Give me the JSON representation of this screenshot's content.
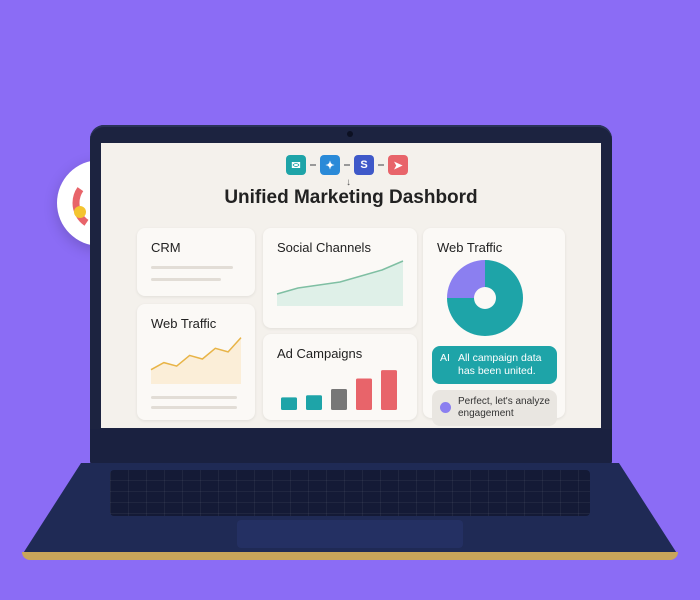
{
  "dashboard": {
    "title": "Unified Marketing Dashbord",
    "integrations": [
      {
        "name": "chat-app",
        "glyph": "✉",
        "color": "#1ea4a8"
      },
      {
        "name": "twitter",
        "glyph": "✦",
        "color": "#2a8ad8"
      },
      {
        "name": "skype",
        "glyph": "S",
        "color": "#3f59c9"
      },
      {
        "name": "send-app",
        "glyph": "➤",
        "color": "#e8646a"
      }
    ],
    "cards": {
      "crm": "CRM",
      "social": "Social Channels",
      "web_traffic_left": "Web Traffic",
      "ads": "Ad Campaigns",
      "web_traffic_right": "Web Traffic"
    },
    "chat": {
      "ai_tag": "AI",
      "ai_message": "All campaign data has been united.",
      "user_message": "Perfect, let's analyze engagement"
    }
  },
  "chart_data": [
    {
      "type": "line",
      "name": "social-channels",
      "y": [
        2,
        3,
        3.5,
        4,
        5,
        6,
        7.5
      ]
    },
    {
      "type": "line",
      "name": "web-traffic",
      "y": [
        2,
        3,
        2.5,
        4,
        3.5,
        5,
        4.5,
        6.5
      ]
    },
    {
      "type": "bar",
      "name": "ad-campaigns",
      "values": [
        3,
        3.5,
        5,
        7.5,
        9.5
      ],
      "colors": [
        "#1ea4a8",
        "#1ea4a8",
        "#777",
        "#e8646a",
        "#e8646a"
      ]
    },
    {
      "type": "pie",
      "name": "web-traffic-donut",
      "values": [
        75,
        25
      ],
      "colors": [
        "#1ea4a8",
        "#8b7ff0"
      ]
    }
  ],
  "colors": {
    "background": "#8b6cf5",
    "accent": "#1ea4a8",
    "laptop": "#1c2340"
  }
}
